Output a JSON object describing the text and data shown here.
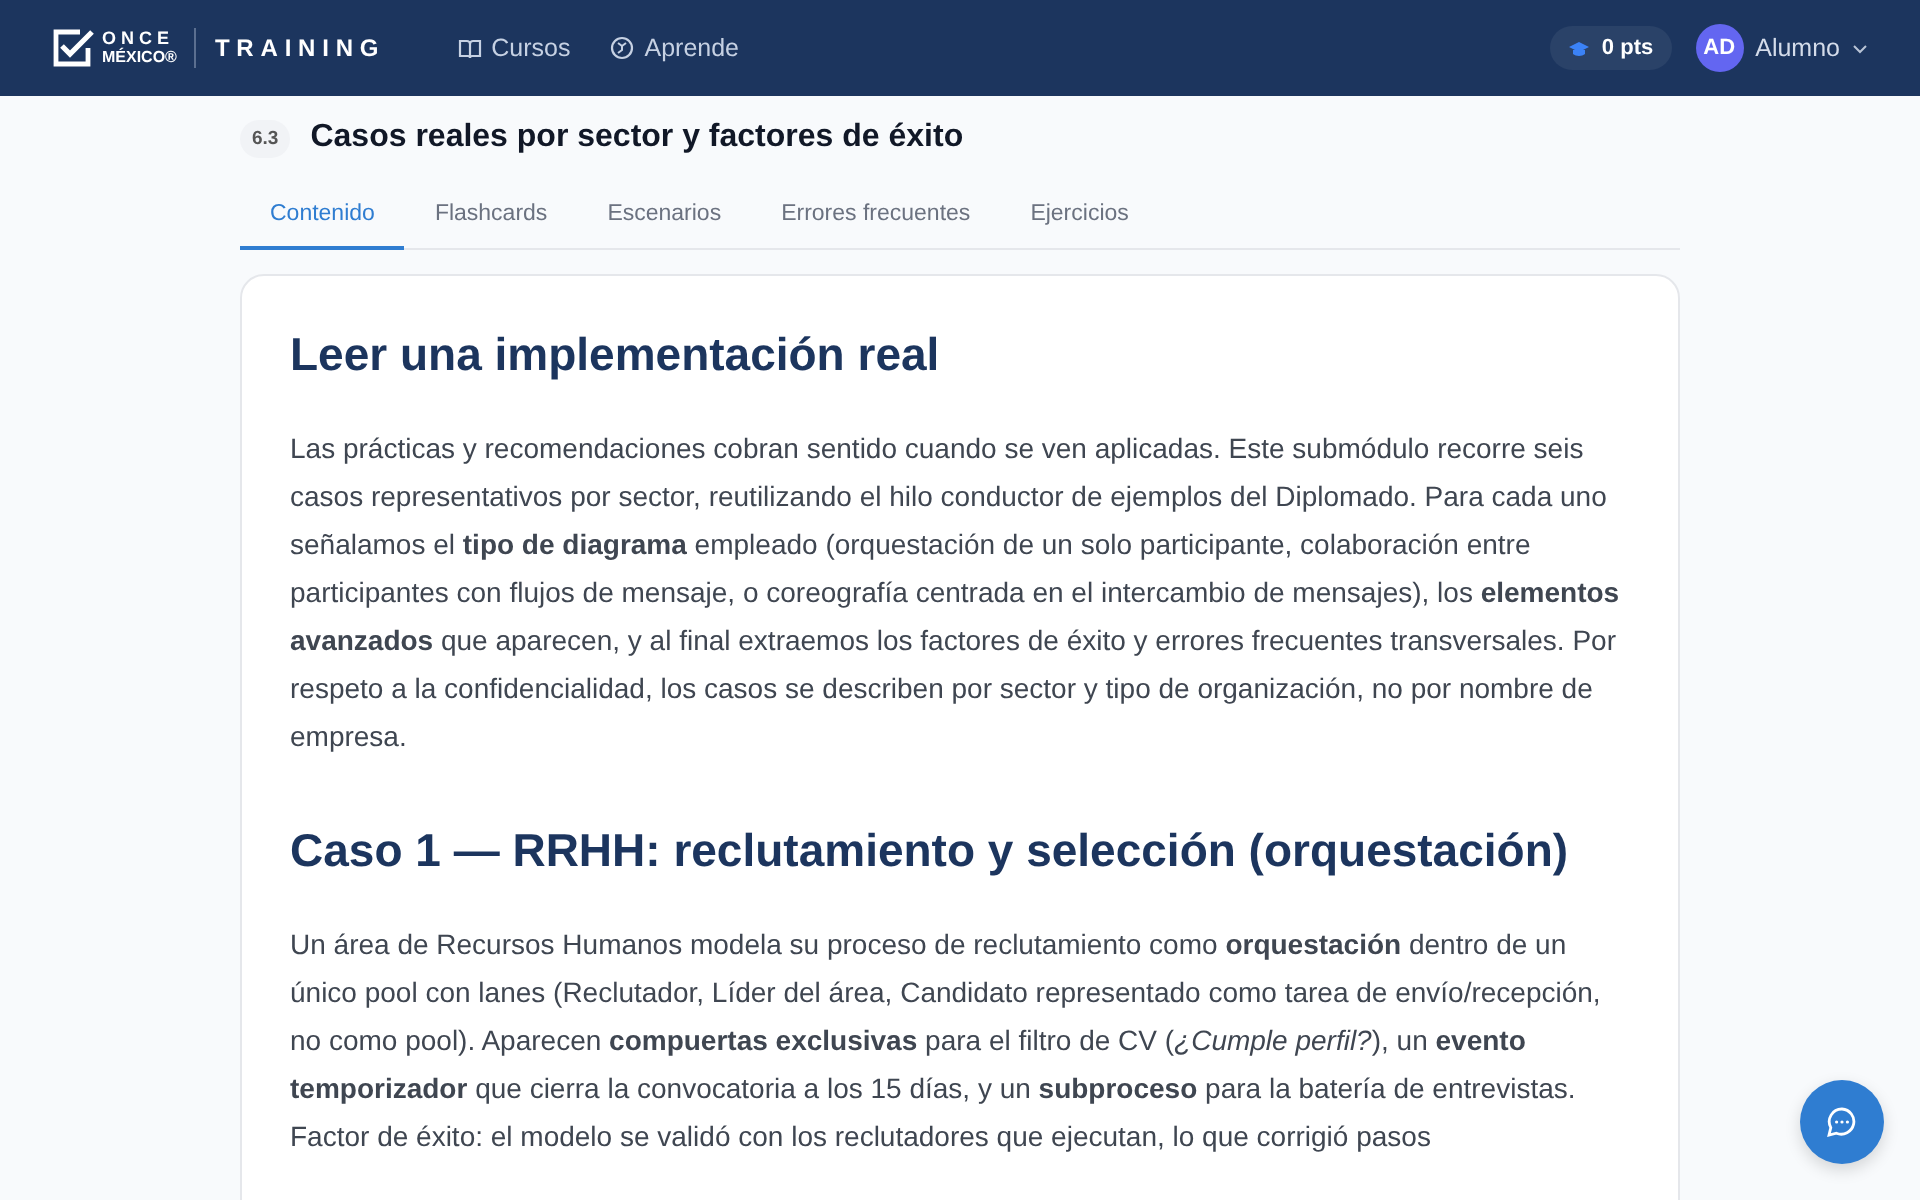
{
  "header": {
    "logo": {
      "line_1": "ONCE",
      "line_2": "MÉXICO®"
    },
    "brand": "TRAINING",
    "nav": [
      {
        "label": "Cursos",
        "selected": false
      },
      {
        "label": "Aprende",
        "selected": false
      }
    ],
    "points": "0 pts",
    "user": {
      "initials": "AD",
      "name": "Alumno"
    }
  },
  "section": {
    "number": "6.3",
    "title": "Casos reales por sector y factores de éxito"
  },
  "tabs": [
    {
      "label": "Contenido",
      "selected": true
    },
    {
      "label": "Flashcards",
      "selected": false
    },
    {
      "label": "Escenarios",
      "selected": false
    },
    {
      "label": "Errores frecuentes",
      "selected": false
    },
    {
      "label": "Ejercicios",
      "selected": false
    }
  ],
  "content": [
    {
      "kind": "heading",
      "text": "Leer una implementación real"
    },
    {
      "kind": "paragraph",
      "text": "Las prácticas y recomendaciones cobran sentido cuando se ven aplicadas. Este submódulo recorre seis casos representativos por sector, reutilizando el hilo conductor de ejemplos del Diplomado. Para cada uno señalamos el **tipo de diagrama** empleado (orquestación de un solo participante, colaboración entre participantes con flujos de mensaje, o coreografía centrada en el intercambio de mensajes), los **elementos avanzados** que aparecen, y al final extraemos los factores de éxito y errores frecuentes transversales. Por respeto a la confidencialidad, los casos se describen por sector y tipo de organización, no por nombre de empresa."
    },
    {
      "kind": "heading",
      "text": "Caso 1 — RRHH: reclutamiento y selección (orquestación)"
    },
    {
      "kind": "paragraph",
      "text": "Un área de Recursos Humanos modela su proceso de reclutamiento como **orquestación** dentro de un único pool con lanes (Reclutador, Líder del área, Candidato representado como tarea de envío/recepción, no como pool). Aparecen **compuertas exclusivas** para el filtro de CV (*¿Cumple perfil?*), un **evento temporizador** que cierra la convocatoria a los 15 días, y un **subproceso** para la batería de entrevistas. Factor de éxito: el modelo se validó con los reclutadores que ejecutan, lo que corrigió pasos"
    }
  ]
}
